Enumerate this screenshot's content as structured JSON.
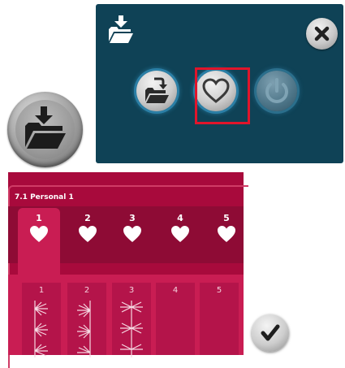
{
  "load_dialog": {
    "header_icon": "load-folder-icon",
    "close_icon": "close-icon",
    "buttons": [
      {
        "icon": "load-from-folder-icon"
      },
      {
        "icon": "heart-icon",
        "selected": true
      },
      {
        "icon": "power-icon"
      }
    ],
    "selection_color": "#e0152b",
    "panel_color": "#0f4256"
  },
  "big_load_button": {
    "icon": "load-folder-icon"
  },
  "personal_menu": {
    "title": "7.1 Personal 1",
    "tabs": [
      {
        "label": "1",
        "icon": "heart-icon",
        "active": true
      },
      {
        "label": "2",
        "icon": "heart-icon"
      },
      {
        "label": "3",
        "icon": "heart-icon"
      },
      {
        "label": "4",
        "icon": "heart-icon"
      },
      {
        "label": "5",
        "icon": "heart-icon"
      }
    ],
    "slots": [
      {
        "label": "1",
        "has_stitch": true
      },
      {
        "label": "2",
        "has_stitch": true
      },
      {
        "label": "3",
        "has_stitch": true
      },
      {
        "label": "4",
        "has_stitch": false
      },
      {
        "label": "5",
        "has_stitch": false
      }
    ],
    "background_color": "#a80a3c"
  },
  "ok_button": {
    "icon": "check-icon"
  }
}
